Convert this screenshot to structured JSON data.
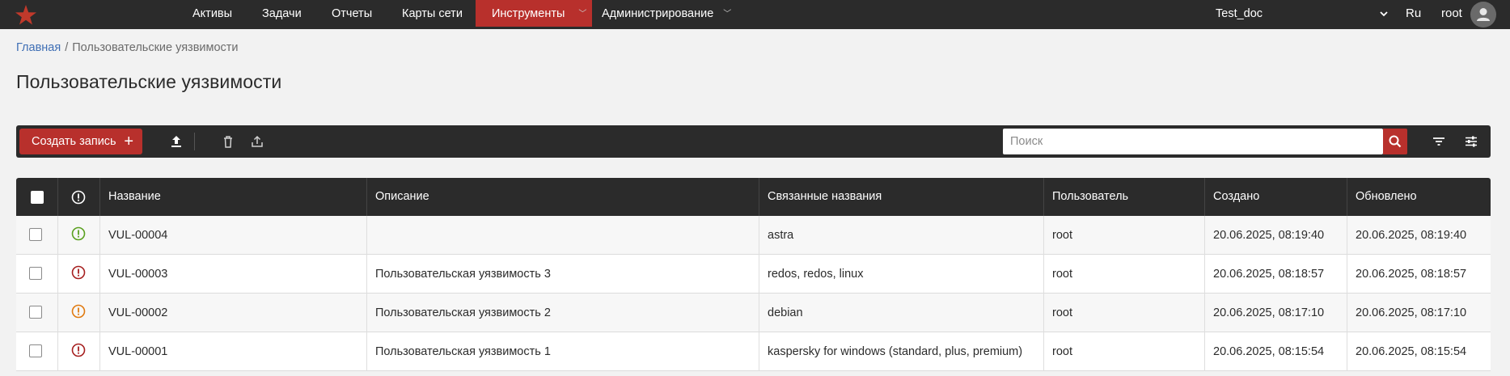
{
  "nav": {
    "items": [
      "Активы",
      "Задачи",
      "Отчеты",
      "Карты сети",
      "Инструменты",
      "Администрирование"
    ],
    "project": "Test_doc",
    "language": "Ru",
    "user": "root"
  },
  "colors": {
    "accent": "#b8302c",
    "dark": "#2b2b2b",
    "sev_low": "#5aa01f",
    "sev_high": "#a61f1f",
    "sev_medium": "#e07a10"
  },
  "breadcrumb": {
    "home": "Главная",
    "separator": "/",
    "current": "Пользовательские уязвимости"
  },
  "page_title": "Пользовательские уязвимости",
  "toolbar": {
    "create_label": "Создать запись",
    "search_placeholder": "Поиск"
  },
  "table": {
    "columns": [
      "Название",
      "Описание",
      "Связанные названия",
      "Пользователь",
      "Создано",
      "Обновлено"
    ],
    "rows": [
      {
        "severity": "low",
        "name": "VUL-00004",
        "description": "",
        "related": "astra",
        "user": "root",
        "created": "20.06.2025, 08:19:40",
        "updated": "20.06.2025, 08:19:40"
      },
      {
        "severity": "high",
        "name": "VUL-00003",
        "description": "Пользовательская уязвимость 3",
        "related": "redos, redos, linux",
        "user": "root",
        "created": "20.06.2025, 08:18:57",
        "updated": "20.06.2025, 08:18:57"
      },
      {
        "severity": "medium",
        "name": "VUL-00002",
        "description": "Пользовательская уязвимость 2",
        "related": "debian",
        "user": "root",
        "created": "20.06.2025, 08:17:10",
        "updated": "20.06.2025, 08:17:10"
      },
      {
        "severity": "high",
        "name": "VUL-00001",
        "description": "Пользовательская уязвимость 1",
        "related": "kaspersky for windows (standard, plus, premium)",
        "user": "root",
        "created": "20.06.2025, 08:15:54",
        "updated": "20.06.2025, 08:15:54"
      }
    ]
  }
}
